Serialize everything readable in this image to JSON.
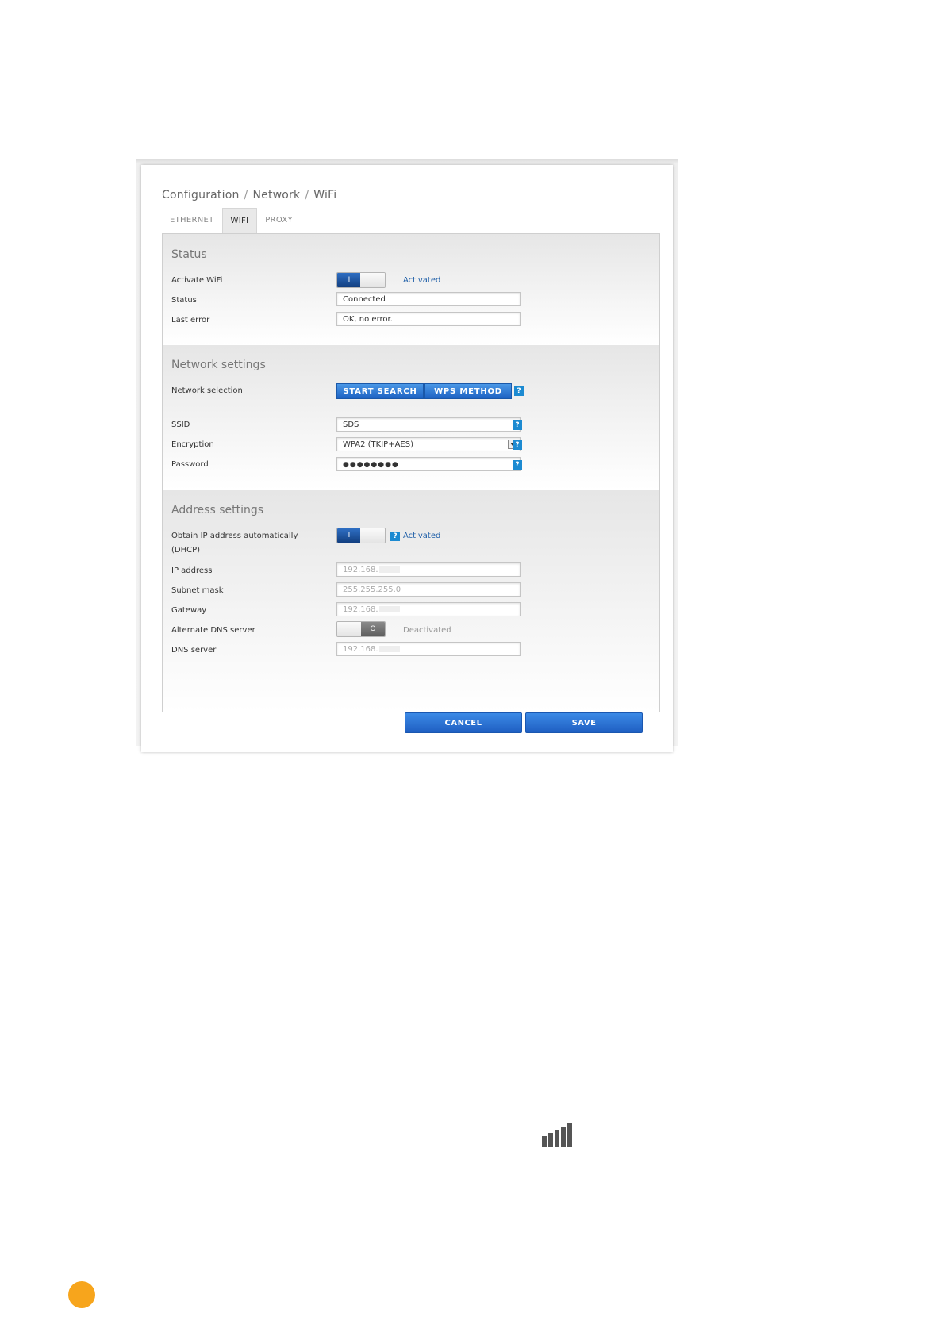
{
  "breadcrumb": {
    "part1": "Configuration",
    "sep": "/",
    "part2": "Network",
    "part3": "WiFi"
  },
  "tabs": [
    {
      "label": "ETHERNET"
    },
    {
      "label": "WIFI"
    },
    {
      "label": "PROXY"
    }
  ],
  "status": {
    "title": "Status",
    "activate_label": "Activate WiFi",
    "activate_toggle": "I",
    "activate_state": "Activated",
    "status_label": "Status",
    "status_value": "Connected",
    "last_error_label": "Last error",
    "last_error_value": "OK, no error."
  },
  "network": {
    "title": "Network settings",
    "selection_label": "Network selection",
    "start_search": "START SEARCH",
    "wps_method": "WPS METHOD",
    "ssid_label": "SSID",
    "ssid_value": "SDS",
    "encryption_label": "Encryption",
    "encryption_value": "WPA2 (TKIP+AES)",
    "password_label": "Password",
    "password_value": "●●●●●●●●"
  },
  "address": {
    "title": "Address settings",
    "dhcp_label_1": "Obtain IP address automatically",
    "dhcp_label_2": "(DHCP)",
    "dhcp_toggle": "I",
    "dhcp_state": "Activated",
    "ip_label": "IP address",
    "ip_value": "192.168.",
    "subnet_label": "Subnet mask",
    "subnet_value": "255.255.255.0",
    "gateway_label": "Gateway",
    "gateway_value": "192.168.",
    "alt_dns_label": "Alternate DNS server",
    "alt_dns_toggle": "O",
    "alt_dns_state": "Deactivated",
    "dns_label": "DNS server",
    "dns_value": "192.168."
  },
  "help_glyph": "?",
  "actions": {
    "cancel": "CANCEL",
    "save": "SAVE"
  },
  "icons": {
    "signal": "signal-bars-icon",
    "dot": "orange-page-marker"
  }
}
